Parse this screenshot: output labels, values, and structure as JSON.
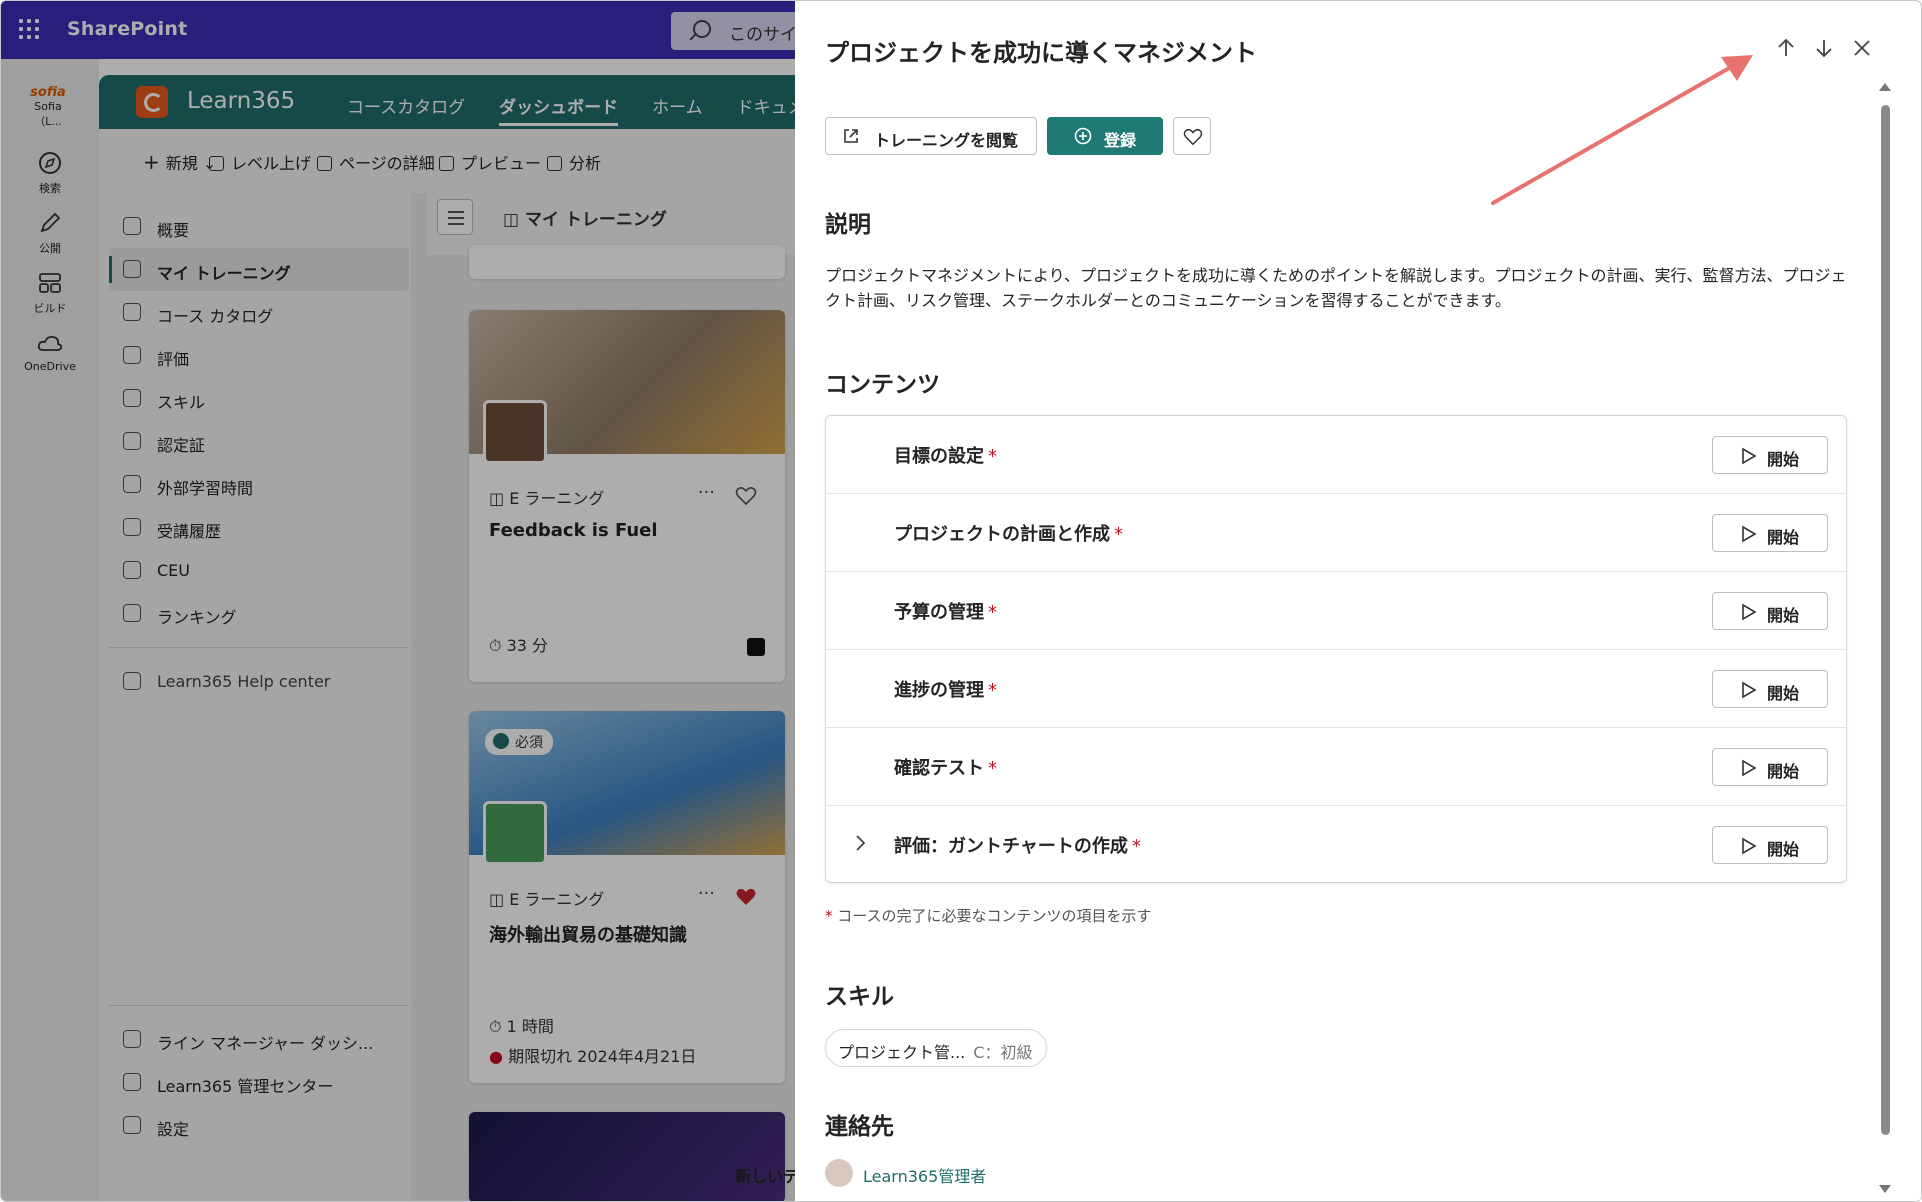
{
  "sharepoint": {
    "title": "SharePoint",
    "search_placeholder": "このサイ"
  },
  "rail": {
    "user_label": "Sofia（L...",
    "logo_text": "sofia",
    "items": [
      {
        "label": "検索",
        "icon": "compass-icon"
      },
      {
        "label": "公開",
        "icon": "pen-icon"
      },
      {
        "label": "ビルド",
        "icon": "grid-icon"
      },
      {
        "label": "OneDrive",
        "icon": "cloud-icon"
      }
    ]
  },
  "app": {
    "name": "Learn365",
    "nav": [
      "コースカタログ",
      "ダッシュボード",
      "ホーム",
      "ドキュメ"
    ],
    "nav_active_index": 1,
    "commands": [
      "新規",
      "レベル上げ",
      "ページの詳細",
      "プレビュー",
      "分析"
    ],
    "left_nav": [
      "概要",
      "マイ トレーニング",
      "コース カタログ",
      "評価",
      "スキル",
      "認定証",
      "外部学習時間",
      "受講履歴",
      "CEU",
      "ランキング"
    ],
    "left_nav_active_index": 1,
    "help": "Learn365 Help center",
    "bottom_nav": [
      "ライン マネージャー ダッシ...",
      "Learn365 管理センター",
      "設定"
    ],
    "my_training_label": "マイ トレーニング",
    "footer_partial": "新しいテ"
  },
  "cards": [
    {
      "type": "E ラーニング",
      "title": "Feedback is Fuel",
      "duration": "33 分",
      "favorited": false
    },
    {
      "type": "E ラーニング",
      "title": "海外輸出貿易の基礎知識",
      "duration": "1 時間",
      "badge": "必須",
      "expired": "期限切れ 2024年4月21日",
      "favorited": true
    }
  ],
  "panel": {
    "title": "プロジェクトを成功に導くマネジメント",
    "controls": [
      "arrow-up-icon",
      "arrow-down-icon",
      "close-icon"
    ],
    "buttons": {
      "view_training": "トレーニングを閲覧",
      "enroll": "登録"
    },
    "description_heading": "説明",
    "description": "プロジェクトマネジメントにより、プロジェクトを成功に導くためのポイントを解説します。プロジェクトの計画、実行、監督方法、プロジェクト計画、リスク管理、ステークホルダーとのコミュニケーションを習得することができます。",
    "contents_heading": "コンテンツ",
    "contents": [
      {
        "name": "目標の設定",
        "required": "*",
        "action": "開始",
        "expandable": false
      },
      {
        "name": "プロジェクトの計画と作成",
        "required": "*",
        "action": "開始",
        "expandable": false
      },
      {
        "name": "予算の管理",
        "required": "*",
        "action": "開始",
        "expandable": false
      },
      {
        "name": "進捗の管理",
        "required": "*",
        "action": "開始",
        "expandable": false
      },
      {
        "name": "確認テスト",
        "required": "*",
        "action": "開始",
        "expandable": false
      },
      {
        "name": "評価：ガントチャートの作成",
        "required": "*",
        "action": "開始",
        "expandable": true
      }
    ],
    "required_note_star": "*",
    "required_note": "コースの完了に必要なコンテンツの項目を示す",
    "skills_heading": "スキル",
    "skill": {
      "name": "プロジェクト管...",
      "level": "C：初級"
    },
    "contact_heading": "連絡先",
    "contact": "Learn365管理者"
  },
  "colors": {
    "sharepoint_bar": "#3b2fb7",
    "brand_teal": "#1f6e6b",
    "primary_button": "#1f7a76",
    "required_star": "#c50f1f",
    "annotation_arrow": "#e8736e"
  }
}
